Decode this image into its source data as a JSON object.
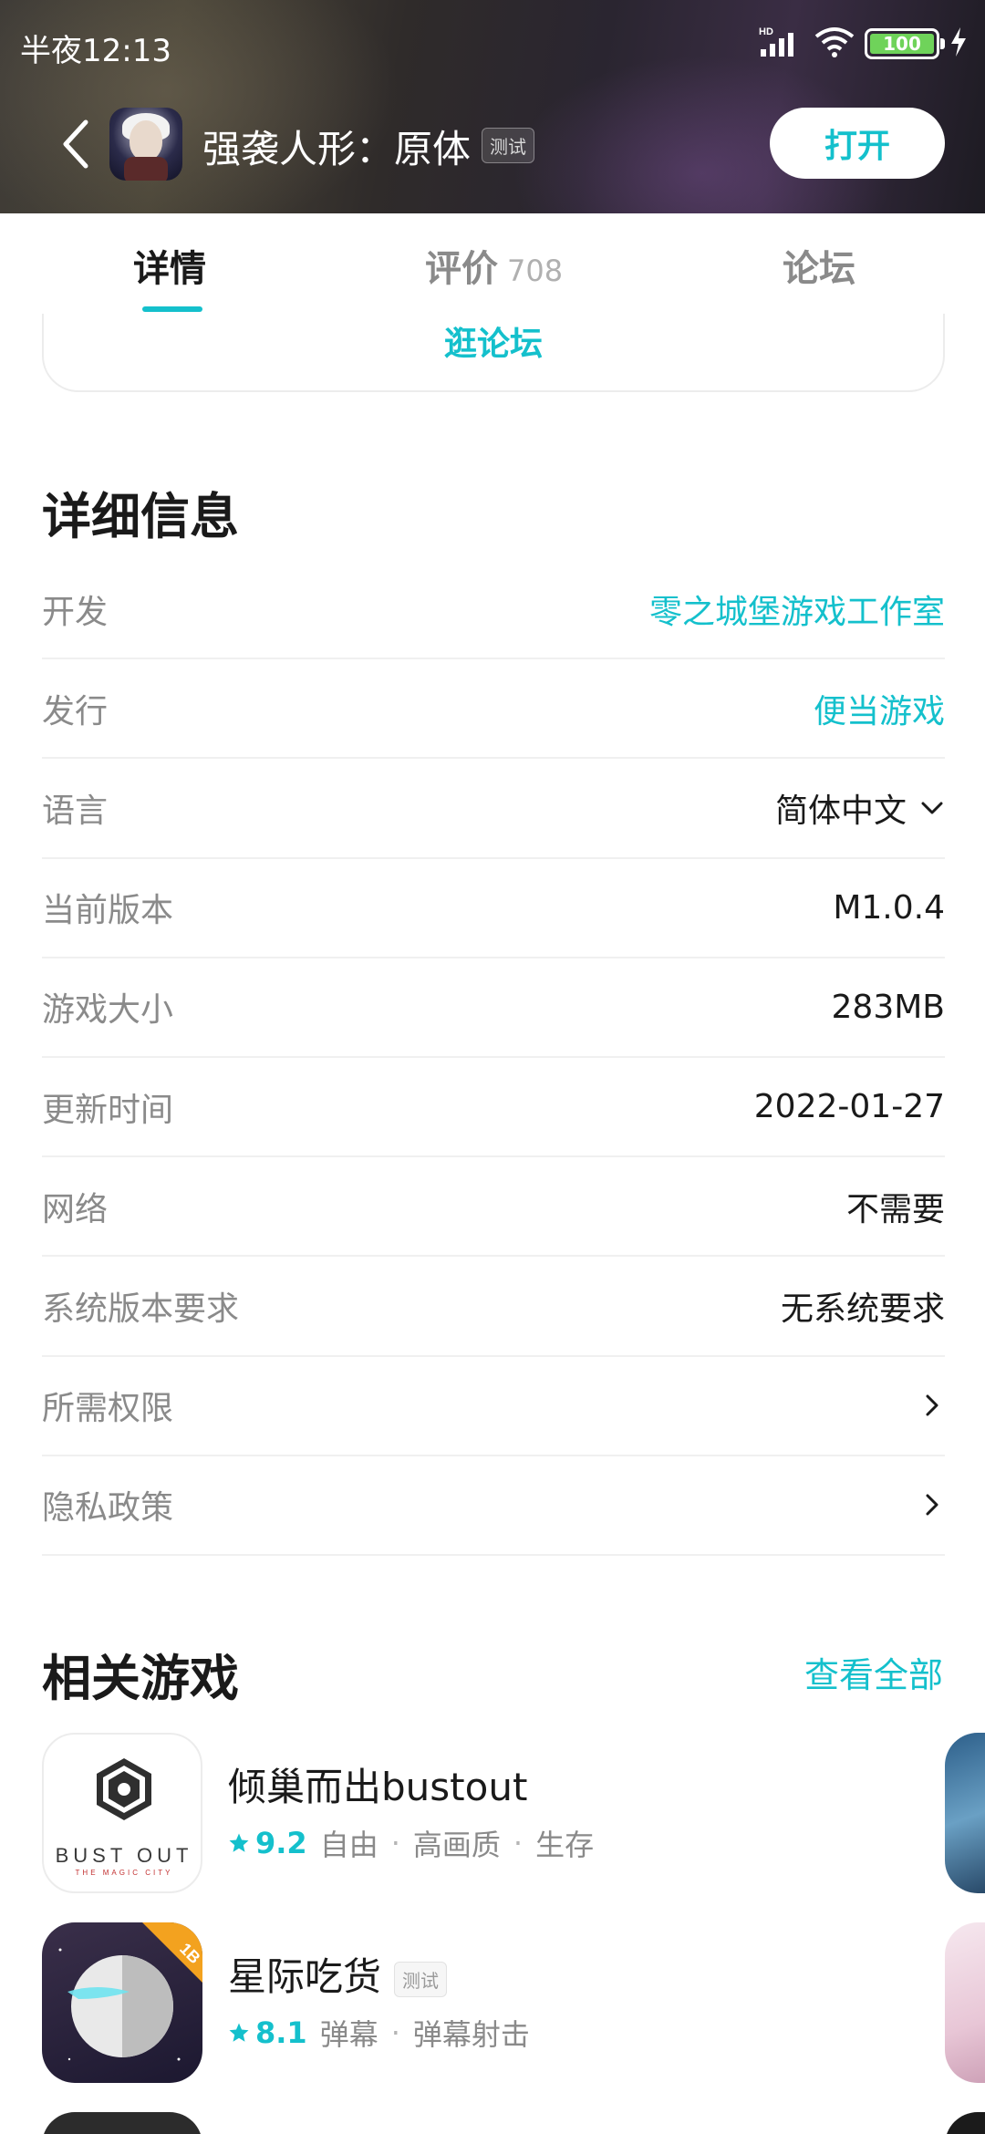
{
  "status_bar": {
    "time": "半夜12:13",
    "network_label": "HD",
    "battery_level": "100"
  },
  "app_bar": {
    "app_name": "强袭人形：原体",
    "test_badge": "测试",
    "open_button": "打开"
  },
  "tabs": [
    {
      "label": "详情",
      "active": true
    },
    {
      "label": "评价",
      "count": "708",
      "active": false
    },
    {
      "label": "论坛",
      "active": false
    }
  ],
  "forum_button": "逛论坛",
  "details": {
    "title": "详细信息",
    "rows": [
      {
        "label": "开发",
        "value": "零之城堡游戏工作室",
        "style": "link"
      },
      {
        "label": "发行",
        "value": "便当游戏",
        "style": "link"
      },
      {
        "label": "语言",
        "value": "简体中文",
        "style": "dropdown"
      },
      {
        "label": "当前版本",
        "value": "M1.0.4",
        "style": "plain"
      },
      {
        "label": "游戏大小",
        "value": "283MB",
        "style": "plain"
      },
      {
        "label": "更新时间",
        "value": "2022-01-27",
        "style": "plain"
      },
      {
        "label": "网络",
        "value": "不需要",
        "style": "plain"
      },
      {
        "label": "系统版本要求",
        "value": "无系统要求",
        "style": "plain"
      },
      {
        "label": "所需权限",
        "value": "",
        "style": "chevron"
      },
      {
        "label": "隐私政策",
        "value": "",
        "style": "chevron"
      }
    ]
  },
  "related": {
    "title": "相关游戏",
    "see_all": "查看全部",
    "games": [
      {
        "name": "倾巢而出bustout",
        "rating": "9.2",
        "tags": [
          "自由",
          "高画质",
          "生存"
        ],
        "icon_text": "BUST OUT",
        "icon_subtext": "THE MAGIC CITY"
      },
      {
        "name": "星际吃货",
        "badge": "测试",
        "rating": "8.1",
        "tags": [
          "弹幕",
          "弹幕射击"
        ],
        "icon_corner_label": "1B"
      }
    ]
  },
  "colors": {
    "accent": "#14c0cc",
    "text_primary": "#1a1a1a",
    "text_secondary": "#8a8a8a",
    "divider": "#f0f0f0"
  }
}
